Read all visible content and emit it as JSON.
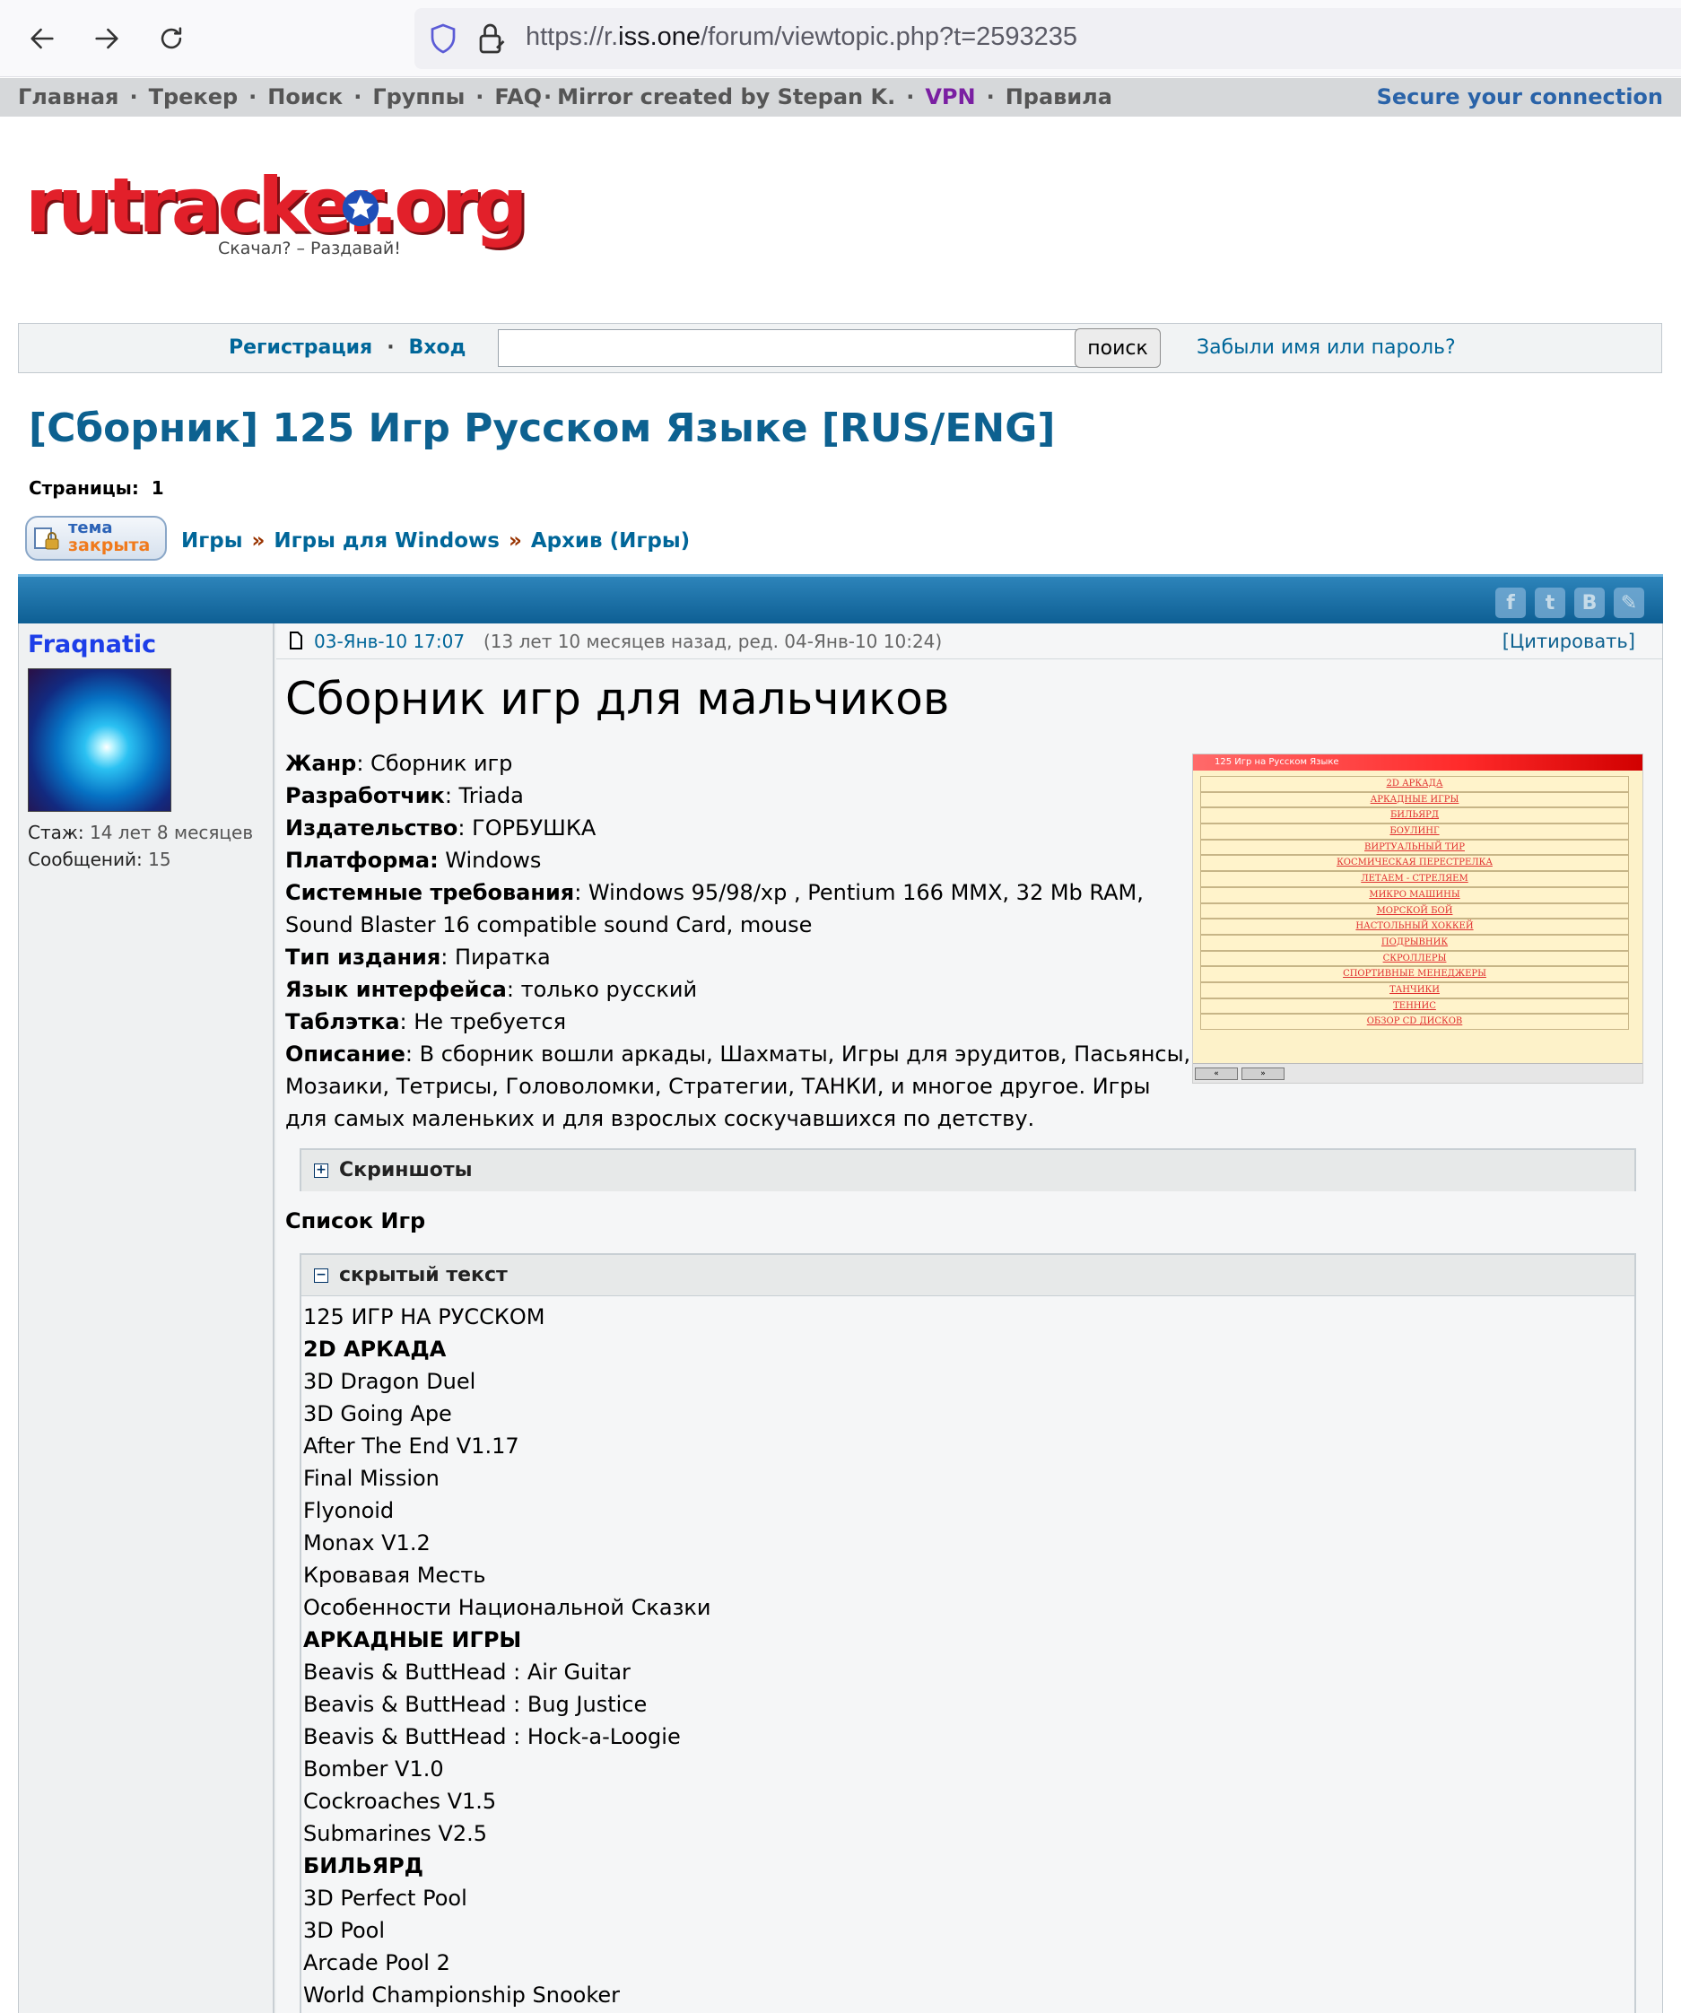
{
  "browser": {
    "url_prefix": "https://r.",
    "url_domain": "iss.one",
    "url_path": "/forum/viewtopic.php?t=2593235"
  },
  "topmenu": {
    "items": [
      "Главная",
      "Трекер",
      "Поиск",
      "Группы",
      "FAQ",
      "Mirror created by Stepan K.",
      "VPN",
      "Правила"
    ],
    "secure": "Secure your connection"
  },
  "logo": {
    "main": "rutracker.org",
    "tagline": "Скачал? – Раздавай!"
  },
  "login": {
    "register": "Регистрация",
    "login": "Вход",
    "search_button": "поиск",
    "forgot": "Забыли имя или пароль?"
  },
  "topic": {
    "title": "[Сборник] 125 Игр Русском Языке [RUS/ENG]",
    "pages_label": "Страницы:",
    "pages_value": "1",
    "closed_line1": "тема",
    "closed_line2": "закрыта",
    "breadcrumbs": [
      "Игры",
      "Игры для Windows",
      "Архив (Игры)"
    ],
    "breadcrumb_sep": "»"
  },
  "share_icons": [
    "facebook-icon",
    "twitter-icon",
    "vk-icon",
    "livejournal-icon"
  ],
  "author": {
    "name": "Fraqnatic",
    "tenure_label": "Стаж:",
    "tenure_value": "14 лет 8 месяцев",
    "posts_label": "Сообщений:",
    "posts_value": "15"
  },
  "post": {
    "date": "03-Янв-10 17:07",
    "ago": "(13 лет 10 месяцев назад, ред. 04-Янв-10 10:24)",
    "quote": "[Цитировать]",
    "heading": "Сборник игр для мальчиков",
    "specs": [
      {
        "k": "Жанр",
        "v": ": Сборник игр"
      },
      {
        "k": "Разработчик",
        "v": ": Triada"
      },
      {
        "k": "Издательство",
        "v": ": ГОРБУШКА"
      },
      {
        "k": "Платформа:",
        "v": " Windows"
      },
      {
        "k": "Системные требования",
        "v": ": Windows 95/98/xp , Pentium 166 MMX, 32 Mb RAM, Sound Blaster 16 compatible sound Card, mouse"
      },
      {
        "k": "Тип издания",
        "v": ": Пиратка"
      },
      {
        "k": "Язык интерфейса",
        "v": ": только русский"
      },
      {
        "k": "Таблэтка",
        "v": ": Не требуется"
      },
      {
        "k": "Описание",
        "v": ": В сборник вошли аркады, Шахматы, Игры для эрудитов, Пасьянсы, Мозаики, Тетрисы, Головоломки, Стратегии, ТАНКИ, и многое другое. Игры для самых маленьких и для взрослых соскучавшихся по детству."
      }
    ],
    "screens_spoiler": "Скриншоты",
    "list_title": "Список Игр",
    "hidden_spoiler": "скрытый текст"
  },
  "screenshot": {
    "window_title": "125 Игр на Русском Языке",
    "menu": [
      "2D АРКАДА",
      "АРКАДНЫЕ ИГРЫ",
      "БИЛЬЯРД",
      "БОУЛИНГ",
      "ВИРТУАЛЬНЫЙ ТИР",
      "КОСМИЧЕСКАЯ ПЕРЕСТРЕЛКА",
      "ЛЕТАЕМ - СТРЕЛЯЕМ",
      "МИКРО МАШИНЫ",
      "МОРСКОЙ БОЙ",
      "НАСТОЛЬНЫЙ ХОККЕЙ",
      "ПОДРЫВНИК",
      "СКРОЛЛЕРЫ",
      "СПОРТИВНЫЕ МЕНЕДЖЕРЫ",
      "ТАНЧИКИ",
      "ТЕННИС",
      "ОБЗОР CD ДИСКОВ"
    ],
    "btn_prev": "«",
    "btn_next": "»"
  },
  "games": [
    {
      "t": "125 ИГР НА РУССКОМ",
      "h": false
    },
    {
      "t": "2D АРКАДА",
      "h": true
    },
    {
      "t": "3D Dragon Duel",
      "h": false
    },
    {
      "t": "3D Going Ape",
      "h": false
    },
    {
      "t": "After The End V1.17",
      "h": false
    },
    {
      "t": "Final Mission",
      "h": false
    },
    {
      "t": "Flyonoid",
      "h": false
    },
    {
      "t": "Monax V1.2",
      "h": false
    },
    {
      "t": "Кровавая Месть",
      "h": false
    },
    {
      "t": "Особенности Национальной Сказки",
      "h": false
    },
    {
      "t": "АРКАДНЫЕ ИГРЫ",
      "h": true
    },
    {
      "t": "Beavis & ButtHead : Air Guitar",
      "h": false
    },
    {
      "t": "Beavis & ButtHead : Bug Justice",
      "h": false
    },
    {
      "t": "Beavis & ButtHead : Hock-a-Loogie",
      "h": false
    },
    {
      "t": "Bomber V1.0",
      "h": false
    },
    {
      "t": "Cockroaches V1.5",
      "h": false
    },
    {
      "t": "Submarines V2.5",
      "h": false
    },
    {
      "t": "БИЛЬЯРД",
      "h": true
    },
    {
      "t": "3D Perfect Pool",
      "h": false
    },
    {
      "t": "3D Pool",
      "h": false
    },
    {
      "t": "Arcade Pool 2",
      "h": false
    },
    {
      "t": "World Championship Snooker",
      "h": false
    }
  ]
}
